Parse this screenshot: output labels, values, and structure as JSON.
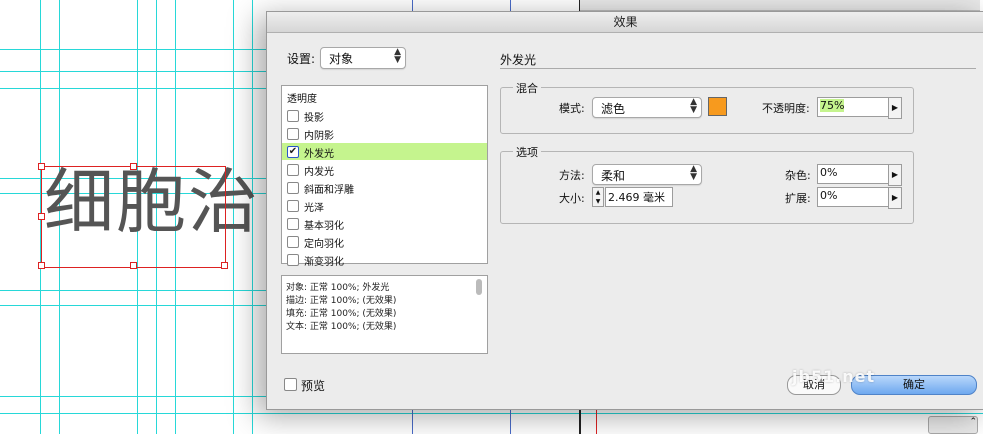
{
  "document": {
    "text": "细胞治",
    "frame_color": "#dd2222",
    "guide_color": "#27d8d8"
  },
  "dialog": {
    "title": "效果",
    "settings_label": "设置:",
    "settings_value": "对象",
    "list_header": "透明度",
    "effects": [
      {
        "label": "投影",
        "checked": false,
        "selected": false
      },
      {
        "label": "内阴影",
        "checked": false,
        "selected": false
      },
      {
        "label": "外发光",
        "checked": true,
        "selected": true
      },
      {
        "label": "内发光",
        "checked": false,
        "selected": false
      },
      {
        "label": "斜面和浮雕",
        "checked": false,
        "selected": false
      },
      {
        "label": "光泽",
        "checked": false,
        "selected": false
      },
      {
        "label": "基本羽化",
        "checked": false,
        "selected": false
      },
      {
        "label": "定向羽化",
        "checked": false,
        "selected": false
      },
      {
        "label": "渐变羽化",
        "checked": false,
        "selected": false
      }
    ],
    "summary_lines": [
      "对象: 正常 100%; 外发光",
      "描边: 正常 100%; (无效果)",
      "填充: 正常 100%; (无效果)",
      "文本: 正常 100%; (无效果)"
    ],
    "preview_label": "预览",
    "section_title": "外发光",
    "blend": {
      "title": "混合",
      "mode_label": "模式:",
      "mode_value": "滤色",
      "color": "#f79a1e",
      "opacity_label": "不透明度:",
      "opacity_value": "75%"
    },
    "options": {
      "title": "选项",
      "method_label": "方法:",
      "method_value": "柔和",
      "size_label": "大小:",
      "size_value": "2.469 毫米",
      "noise_label": "杂色:",
      "noise_value": "0%",
      "spread_label": "扩展:",
      "spread_value": "0%"
    },
    "cancel_label": "取消",
    "ok_label": "确定",
    "watermark": "jb51.net"
  }
}
